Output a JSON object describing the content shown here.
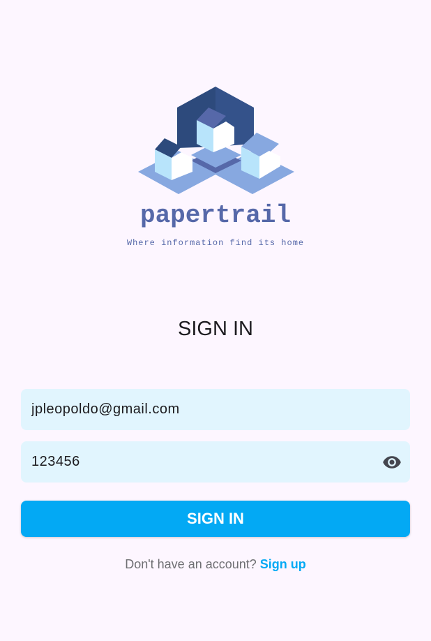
{
  "brand": {
    "name": "papertrail",
    "tagline": "Where information find its home",
    "logo_icon": "isometric-houses-logo",
    "color": "#5668a9"
  },
  "form": {
    "title": "SIGN IN",
    "email_value": "jpleopoldo@gmail.com",
    "password_value": "123456",
    "password_toggle_icon": "eye-icon",
    "submit_label": "SIGN IN"
  },
  "signup": {
    "prompt": "Don't have an account?",
    "link_label": "Sign up"
  },
  "colors": {
    "background": "#fdf6ff",
    "field_background": "#e1f5fe",
    "accent": "#03a9f4",
    "logo_dark": "#2d4a7c",
    "logo_mid": "#5668a9",
    "logo_light": "#87a8e0",
    "logo_pale": "#b8e4fb"
  }
}
